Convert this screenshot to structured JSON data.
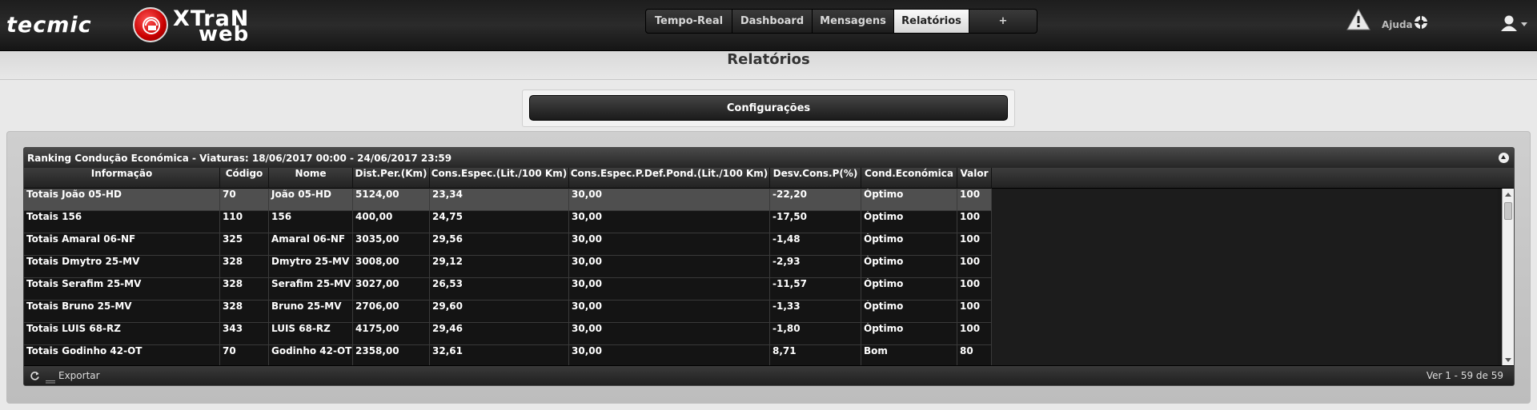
{
  "brand": {
    "company": "tecmic",
    "product_line1": "XTraN",
    "product_line2": "web"
  },
  "nav": {
    "tabs": [
      {
        "label": "Tempo-Real"
      },
      {
        "label": "Dashboard"
      },
      {
        "label": "Mensagens"
      },
      {
        "label": "Relatórios",
        "active": true
      },
      {
        "label": "+"
      }
    ]
  },
  "header_right": {
    "warning_icon": "warning-icon",
    "help_label": "Ajuda",
    "help_icon": "lifebuoy-icon",
    "user_icon": "user-icon"
  },
  "page": {
    "title": "Relatórios",
    "config_button": "Configurações"
  },
  "grid": {
    "caption": "Ranking Condução Económica - Viaturas: 18/06/2017 00:00 - 24/06/2017 23:59",
    "columns": [
      {
        "label": "Informação"
      },
      {
        "label": "Código"
      },
      {
        "label": "Nome"
      },
      {
        "label": "Dist.Per.(Km)"
      },
      {
        "label": "Cons.Espec.(Lit./100 Km)"
      },
      {
        "label": "Cons.Espec.P.Def.Pond.(Lit./100 Km)"
      },
      {
        "label": "Desv.Cons.P(%)"
      },
      {
        "label": "Cond.Económica"
      },
      {
        "label": "Valor"
      }
    ],
    "rows": [
      [
        "Totais João 05-HD",
        "70",
        "João 05-HD",
        "5124,00",
        "23,34",
        "30,00",
        "-22,20",
        "Óptimo",
        "100"
      ],
      [
        "Totais 156",
        "110",
        "156",
        "400,00",
        "24,75",
        "30,00",
        "-17,50",
        "Óptimo",
        "100"
      ],
      [
        "Totais Amaral 06-NF",
        "325",
        "Amaral 06-NF",
        "3035,00",
        "29,56",
        "30,00",
        "-1,48",
        "Óptimo",
        "100"
      ],
      [
        "Totais Dmytro 25-MV",
        "328",
        "Dmytro 25-MV",
        "3008,00",
        "29,12",
        "30,00",
        "-2,93",
        "Óptimo",
        "100"
      ],
      [
        "Totais Serafim 25-MV",
        "328",
        "Serafim 25-MV",
        "3027,00",
        "26,53",
        "30,00",
        "-11,57",
        "Óptimo",
        "100"
      ],
      [
        "Totais Bruno 25-MV",
        "328",
        "Bruno 25-MV",
        "2706,00",
        "29,60",
        "30,00",
        "-1,33",
        "Óptimo",
        "100"
      ],
      [
        "Totais LUIS 68-RZ",
        "343",
        "LUIS 68-RZ",
        "4175,00",
        "29,46",
        "30,00",
        "-1,80",
        "Óptimo",
        "100"
      ],
      [
        "Totais Godinho 42-OT",
        "70",
        "Godinho 42-OT",
        "2358,00",
        "32,61",
        "30,00",
        "8,71",
        "Bom",
        "80"
      ]
    ],
    "selected_row": 0,
    "footer": {
      "export_label": "Exportar",
      "pager_text": "Ver 1 - 59 de 59"
    }
  },
  "colors": {
    "topbar": "#1f1f1f",
    "grid_bg": "#141414",
    "selected_row": "#4f4f4f",
    "active_tab": "#f0f0f0",
    "logo_red": "#c80000"
  }
}
